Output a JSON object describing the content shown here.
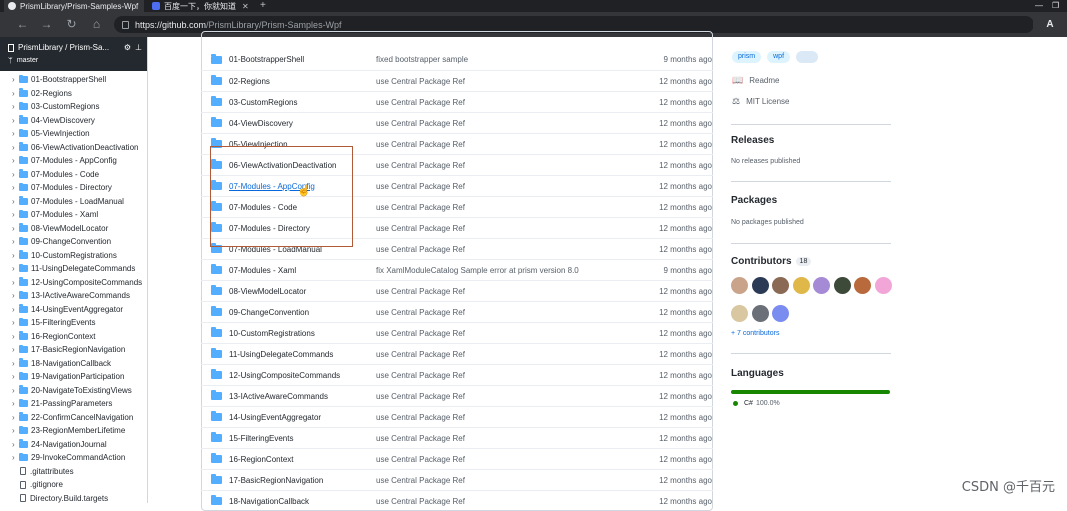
{
  "browser": {
    "tabs": [
      {
        "title": "PrismLibrary/Prism-Samples-Wpf",
        "active": true
      },
      {
        "title": "百度一下，你就知道",
        "active": false
      }
    ],
    "url_host": "https://github.com",
    "url_path": "/PrismLibrary/Prism-Samples-Wpf",
    "new_tab_label": "+",
    "right_label": "A"
  },
  "sidebar": {
    "repo": "PrismLibrary / Prism-Sa...",
    "branch": "master",
    "folders": [
      "01-BootstrapperShell",
      "02-Regions",
      "03-CustomRegions",
      "04-ViewDiscovery",
      "05-ViewInjection",
      "06-ViewActivationDeactivation",
      "07-Modules - AppConfig",
      "07-Modules - Code",
      "07-Modules - Directory",
      "07-Modules - LoadManual",
      "07-Modules - Xaml",
      "08-ViewModelLocator",
      "09-ChangeConvention",
      "10-CustomRegistrations",
      "11-UsingDelegateCommands",
      "12-UsingCompositeCommands",
      "13-IActiveAwareCommands",
      "14-UsingEventAggregator",
      "15-FilteringEvents",
      "16-RegionContext",
      "17-BasicRegionNavigation",
      "18-NavigationCallback",
      "19-NavigationParticipation",
      "20-NavigateToExistingViews",
      "21-PassingParameters",
      "22-ConfirmCancelNavigation",
      "23-RegionMemberLifetime",
      "24-NavigationJournal",
      "29-InvokeCommandAction"
    ],
    "files": [
      ".gitattributes",
      ".gitignore",
      "Directory.Build.targets"
    ]
  },
  "files": [
    {
      "name": "01-BootstrapperShell",
      "message": "fixed bootstrapper sample",
      "age": "9 months ago"
    },
    {
      "name": "02-Regions",
      "message": "use Central Package Ref",
      "age": "12 months ago"
    },
    {
      "name": "03-CustomRegions",
      "message": "use Central Package Ref",
      "age": "12 months ago"
    },
    {
      "name": "04-ViewDiscovery",
      "message": "use Central Package Ref",
      "age": "12 months ago"
    },
    {
      "name": "05-ViewInjection",
      "message": "use Central Package Ref",
      "age": "12 months ago"
    },
    {
      "name": "06-ViewActivationDeactivation",
      "message": "use Central Package Ref",
      "age": "12 months ago"
    },
    {
      "name": "07-Modules - AppConfig",
      "message": "use Central Package Ref",
      "age": "12 months ago",
      "hovered": true
    },
    {
      "name": "07-Modules - Code",
      "message": "use Central Package Ref",
      "age": "12 months ago"
    },
    {
      "name": "07-Modules - Directory",
      "message": "use Central Package Ref",
      "age": "12 months ago"
    },
    {
      "name": "07-Modules - LoadManual",
      "message": "use Central Package Ref",
      "age": "12 months ago"
    },
    {
      "name": "07-Modules - Xaml",
      "message": "fix XamlModuleCatalog Sample error at prism version 8.0",
      "age": "9 months ago"
    },
    {
      "name": "08-ViewModelLocator",
      "message": "use Central Package Ref",
      "age": "12 months ago"
    },
    {
      "name": "09-ChangeConvention",
      "message": "use Central Package Ref",
      "age": "12 months ago"
    },
    {
      "name": "10-CustomRegistrations",
      "message": "use Central Package Ref",
      "age": "12 months ago"
    },
    {
      "name": "11-UsingDelegateCommands",
      "message": "use Central Package Ref",
      "age": "12 months ago"
    },
    {
      "name": "12-UsingCompositeCommands",
      "message": "use Central Package Ref",
      "age": "12 months ago"
    },
    {
      "name": "13-IActiveAwareCommands",
      "message": "use Central Package Ref",
      "age": "12 months ago"
    },
    {
      "name": "14-UsingEventAggregator",
      "message": "use Central Package Ref",
      "age": "12 months ago"
    },
    {
      "name": "15-FilteringEvents",
      "message": "use Central Package Ref",
      "age": "12 months ago"
    },
    {
      "name": "16-RegionContext",
      "message": "use Central Package Ref",
      "age": "12 months ago"
    },
    {
      "name": "17-BasicRegionNavigation",
      "message": "use Central Package Ref",
      "age": "12 months ago"
    },
    {
      "name": "18-NavigationCallback",
      "message": "use Central Package Ref",
      "age": "12 months ago"
    }
  ],
  "about": {
    "topics": [
      "prism",
      "wpf"
    ],
    "readme": "Readme",
    "license": "MIT License"
  },
  "releases": {
    "title": "Releases",
    "subtitle": "No releases published"
  },
  "packages": {
    "title": "Packages",
    "subtitle": "No packages published"
  },
  "contributors": {
    "title": "Contributors",
    "count": "18",
    "more": "+ 7 contributors",
    "avatar_colors": [
      "#c9a48a",
      "#2b3a55",
      "#8a6a55",
      "#e0b84a",
      "#a58bd6",
      "#3d4a3a",
      "#b86a3c",
      "#f2a6d8",
      "#d8c7a0",
      "#6b6f77",
      "#7b8cf0"
    ]
  },
  "languages": {
    "title": "Languages",
    "name": "C#",
    "percent": "100.0%",
    "color": "#178600"
  },
  "watermark": "CSDN @千百元"
}
